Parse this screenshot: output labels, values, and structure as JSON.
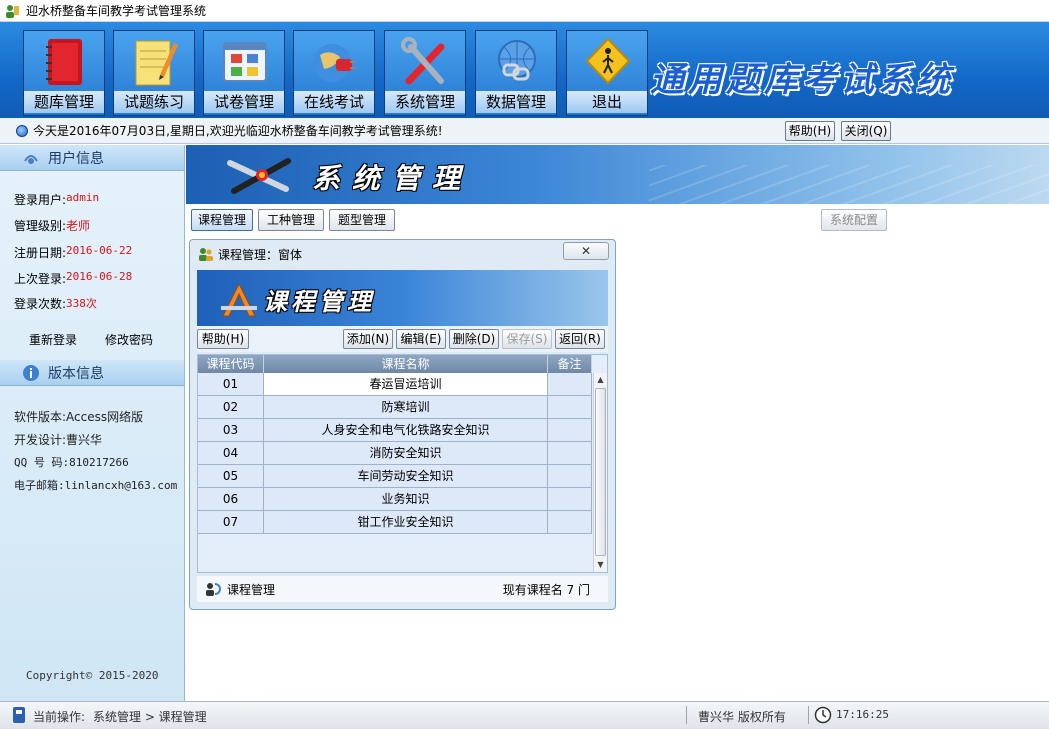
{
  "window": {
    "title": "迎水桥整备车间教学考试管理系统",
    "icon": "app-user-icon"
  },
  "toolbar": {
    "buttons": [
      {
        "label": "题库管理",
        "icon": "book-icon"
      },
      {
        "label": "试题练习",
        "icon": "notepad-pencil-icon"
      },
      {
        "label": "试卷管理",
        "icon": "window-grid-icon"
      },
      {
        "label": "在线考试",
        "icon": "globe-plug-icon"
      },
      {
        "label": "系统管理",
        "icon": "tools-icon"
      },
      {
        "label": "数据管理",
        "icon": "data-link-icon"
      },
      {
        "label": "退出",
        "icon": "exit-sign-icon"
      }
    ],
    "brand_title": "通用题库考试系统"
  },
  "welcome": {
    "text": "今天是2016年07月03日,星期日,欢迎光临迎水桥整备车间教学考试管理系统!",
    "help_label": "帮助(H)",
    "close_label": "关闭(Q)"
  },
  "user_panel": {
    "title": "用户信息",
    "rows": [
      {
        "label": "登录用户:",
        "value": "admin"
      },
      {
        "label": "管理级别:",
        "value": "老师"
      },
      {
        "label": "注册日期:",
        "value": "2016-06-22"
      },
      {
        "label": "上次登录:",
        "value": "2016-06-28"
      },
      {
        "label": "登录次数:",
        "value": "338次"
      }
    ],
    "relogin_label": "重新登录",
    "change_password_label": "修改密码"
  },
  "version_panel": {
    "title": "版本信息",
    "rows": [
      "软件版本:Access网络版",
      "开发设计:曹兴华",
      "QQ 号 码:810217266",
      "电子邮箱:linlancxh@163.com"
    ],
    "copyright": "Copyright© 2015-2020"
  },
  "content": {
    "banner_title": "系统管理",
    "tabs": [
      {
        "label": "课程管理",
        "active": true
      },
      {
        "label": "工种管理",
        "active": false
      },
      {
        "label": "题型管理",
        "active": false
      }
    ],
    "system_config_label": "系统配置"
  },
  "course_window": {
    "title": "课程管理：窗体",
    "close_glyph": "✕",
    "banner_title": "课程管理",
    "buttons": {
      "help": "帮助(H)",
      "add": "添加(N)",
      "edit": "编辑(E)",
      "delete": "删除(D)",
      "save": "保存(S)",
      "back": "返回(R)"
    },
    "columns": [
      "课程代码",
      "课程名称",
      "备注"
    ],
    "rows": [
      {
        "code": "01",
        "name": "春运冒运培训",
        "note": ""
      },
      {
        "code": "02",
        "name": "防寒培训",
        "note": ""
      },
      {
        "code": "03",
        "name": "人身安全和电气化铁路安全知识",
        "note": ""
      },
      {
        "code": "04",
        "name": "消防安全知识",
        "note": ""
      },
      {
        "code": "05",
        "name": "车间劳动安全知识",
        "note": ""
      },
      {
        "code": "06",
        "name": "业务知识",
        "note": ""
      },
      {
        "code": "07",
        "name": "钳工作业安全知识",
        "note": ""
      }
    ],
    "status_label": "课程管理",
    "status_count": "现有课程名 7 门"
  },
  "statusbar": {
    "current_op": "当前操作:",
    "path": "系统管理 > 课程管理",
    "copyright_owner": "曹兴华  版权所有",
    "time": "17:16:25"
  },
  "colors": {
    "toolbar_blue": "#1368c7",
    "value_red": "#d4151b",
    "grid_header": "#6f88a6"
  }
}
